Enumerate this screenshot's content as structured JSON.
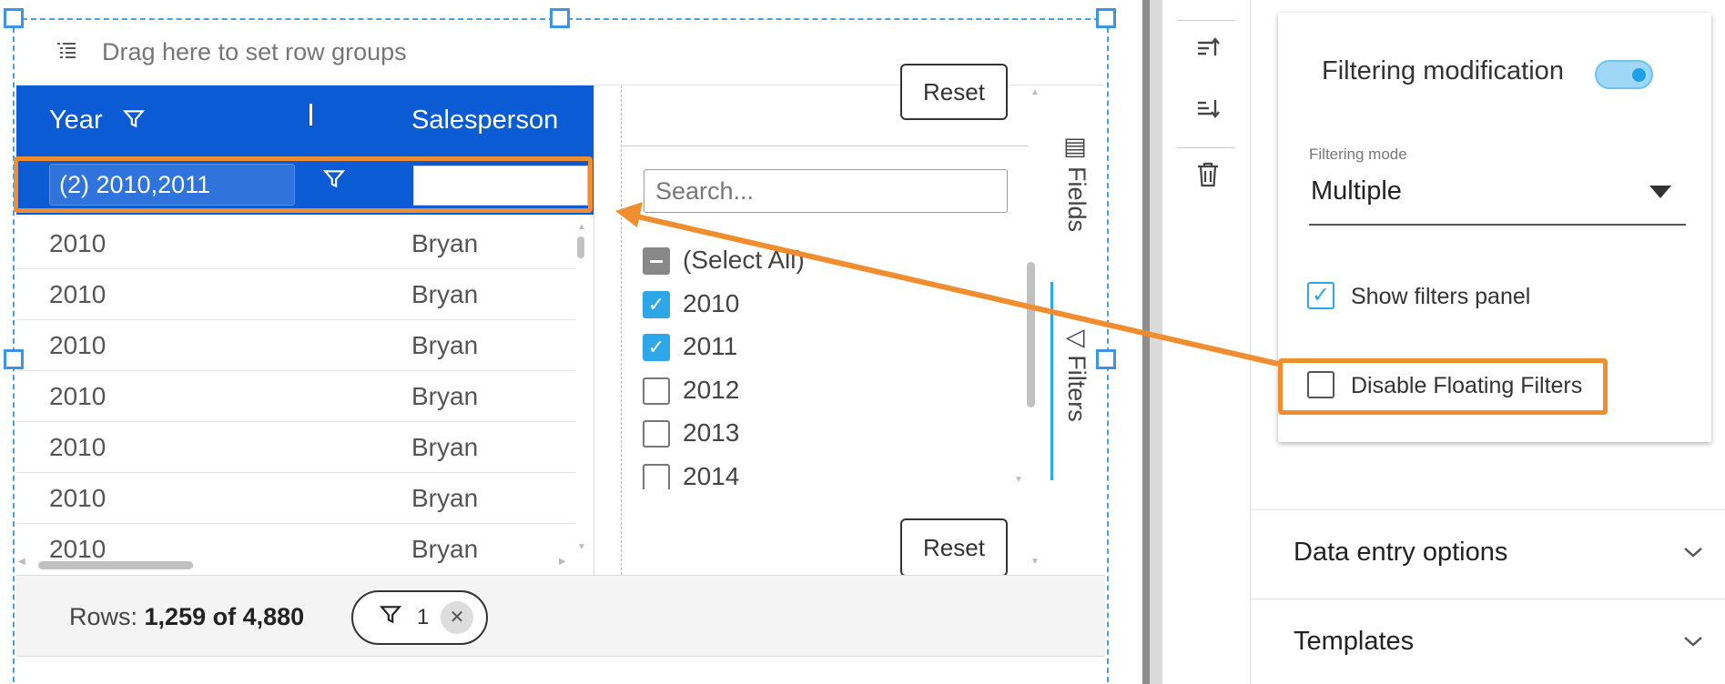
{
  "grid": {
    "row_group_placeholder": "Drag here to set row groups",
    "columns": [
      "Year",
      "Salesperson"
    ],
    "floating_filter_value": "(2) 2010,2011",
    "rows": [
      [
        "2010",
        "Bryan"
      ],
      [
        "2010",
        "Bryan"
      ],
      [
        "2010",
        "Bryan"
      ],
      [
        "2010",
        "Bryan"
      ],
      [
        "2010",
        "Bryan"
      ],
      [
        "2010",
        "Bryan"
      ],
      [
        "2010",
        "Bryan"
      ]
    ],
    "status": {
      "rows_label": "Rows:",
      "rows_value": "1,259 of 4,880",
      "filter_chip_count": "1"
    }
  },
  "filter_panel": {
    "reset_label": "Reset",
    "search_placeholder": "Search...",
    "items": [
      {
        "label": "(Select All)",
        "state": "indeterminate"
      },
      {
        "label": "2010",
        "state": "checked"
      },
      {
        "label": "2011",
        "state": "checked"
      },
      {
        "label": "2012",
        "state": "unchecked"
      },
      {
        "label": "2013",
        "state": "unchecked"
      },
      {
        "label": "2014",
        "state": "unchecked"
      }
    ],
    "side_tabs": [
      "Fields",
      "Filters"
    ]
  },
  "settings": {
    "filtering_modification_label": "Filtering modification",
    "filtering_modification_enabled": true,
    "filtering_mode_label": "Filtering mode",
    "filtering_mode_value": "Multiple",
    "show_filters_panel_label": "Show filters panel",
    "show_filters_panel_checked": true,
    "disable_floating_filters_label": "Disable Floating Filters",
    "disable_floating_filters_checked": false,
    "accordions": [
      "Data entry options",
      "Templates"
    ]
  },
  "colors": {
    "header_blue": "#0a5bd4",
    "accent": "#2ea7e8",
    "annotation": "#f08d2e"
  }
}
